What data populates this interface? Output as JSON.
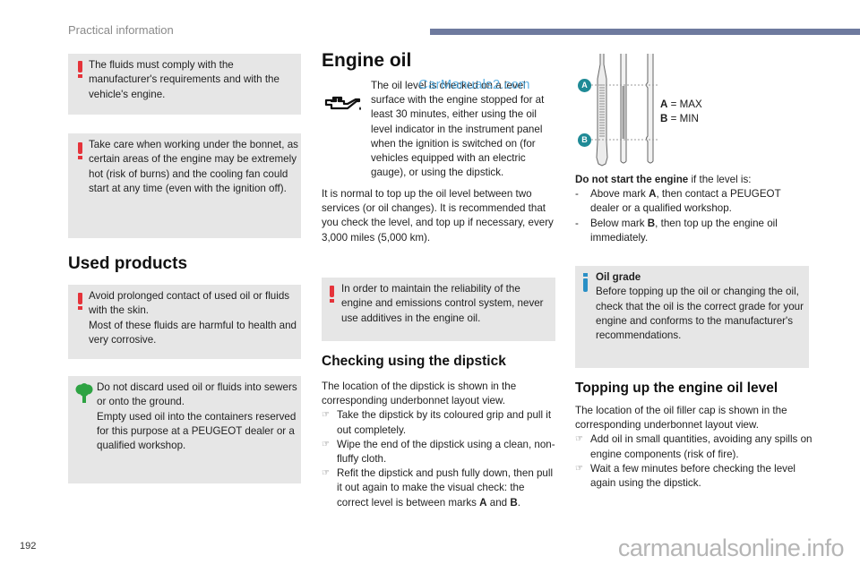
{
  "header": {
    "section_title": "Practical information",
    "accent_color": "#6e7a9e"
  },
  "left": {
    "box1": {
      "icon": "warning-icon",
      "text": "The fluids must comply with the manufacturer's requirements and with the vehicle's engine."
    },
    "box2": {
      "icon": "warning-icon",
      "text": "Take care when working under the bonnet, as certain areas of the engine may be extremely hot (risk of burns) and the cooling fan could start at any time (even with the ignition off)."
    },
    "used_products_title": "Used products",
    "box3": {
      "icon": "warning-icon",
      "lines": [
        "Avoid prolonged contact of used oil or fluids with the skin.",
        "Most of these fluids are harmful to health and very corrosive."
      ]
    },
    "box4": {
      "icon": "tree-icon",
      "lines": [
        "Do not discard used oil or fluids into sewers or onto the ground.",
        "Empty used oil into the containers reserved for this purpose at a PEUGEOT dealer or a qualified workshop."
      ]
    }
  },
  "middle": {
    "title": "Engine oil",
    "intro_icon": "oil-can-icon",
    "intro": "The oil level is checked on a level surface with the engine stopped for at least 30 minutes, either using the oil level indicator in the instrument panel when the ignition is switched on (for vehicles equipped with an electric gauge), or using the dipstick.",
    "watermark": "CarManuals2.com",
    "normal_text": "It is normal to top up the oil level between two services (or oil changes). It is recommended that you check the level, and top up if necessary, every 3,000 miles (5,000 km).",
    "warning_box": {
      "icon": "warning-icon",
      "text": "In order to maintain the reliability of the engine and emissions control system, never use additives in the engine oil."
    },
    "dipstick_title": "Checking using the dipstick",
    "dipstick_intro": "The location of the dipstick is shown in the corresponding underbonnet layout view.",
    "dipstick_steps": [
      "Take the dipstick by its coloured grip and pull it out completely.",
      "Wipe the end of the dipstick using a clean, non-fluffy cloth.",
      "Refit the dipstick and push fully down, then pull it out again to make the visual check: the correct level is between marks"
    ],
    "mark_a": "A",
    "mark_and": "and",
    "mark_b": "B",
    "period": "."
  },
  "right": {
    "diagram": {
      "label_a": "A",
      "label_b": "B",
      "legend_a_key": "A",
      "legend_a_val": "= MAX",
      "legend_b_key": "B",
      "legend_b_val": "= MIN",
      "badge_color": "#1f8a96"
    },
    "do_not_start_bold": "Do not start the engine",
    "do_not_start_rest": " if the level is:",
    "conditions": [
      {
        "pre": "Above mark ",
        "mark": "A",
        "post": ", then contact a PEUGEOT dealer or a qualified workshop."
      },
      {
        "pre": "Below mark ",
        "mark": "B",
        "post": ", then top up the engine oil immediately."
      }
    ],
    "info_box": {
      "icon": "info-icon",
      "title": "Oil grade",
      "text": "Before topping up the oil or changing the oil, check that the oil is the correct grade for your engine and conforms to the manufacturer's recommendations."
    },
    "topping_title": "Topping up the engine oil level",
    "topping_intro": "The location of the oil filler cap is shown in the corresponding underbonnet layout view.",
    "topping_steps": [
      "Add oil in small quantities, avoiding any spills on engine components (risk of fire).",
      "Wait a few minutes before checking the level again using the dipstick."
    ]
  },
  "footer": {
    "page_number": "192",
    "site": "carmanualsonline.info"
  }
}
